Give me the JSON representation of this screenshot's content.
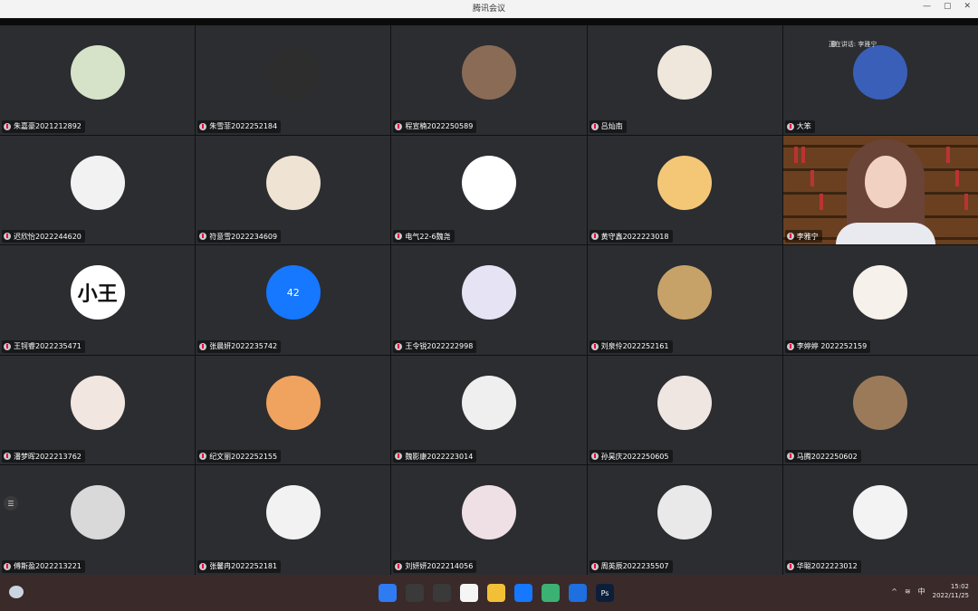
{
  "window": {
    "title": "腾讯会议"
  },
  "speaking": {
    "label": "正在讲话: 李雅宁"
  },
  "participants": [
    {
      "name": "朱嘉豪2021212892"
    },
    {
      "name": "朱雪菲2022252184"
    },
    {
      "name": "程宣楠2022250589"
    },
    {
      "name": "吕灿南"
    },
    {
      "name": "大笨"
    },
    {
      "name": "迟欣怡2022244620"
    },
    {
      "name": "符意雪2022234609"
    },
    {
      "name": "电气22-6魏尧"
    },
    {
      "name": "黄守鑫2022223018"
    },
    {
      "name": "李雅宁"
    },
    {
      "name": "王钶睿2022235471",
      "avatar_text": "小王"
    },
    {
      "name": "张晨妍2022235742",
      "avatar_text": "42"
    },
    {
      "name": "王令锐2022222998"
    },
    {
      "name": "刘泉伶2022252161"
    },
    {
      "name": "李婷婷 2022252159"
    },
    {
      "name": "潘梦晖2022213762"
    },
    {
      "name": "纪文丽2022252155"
    },
    {
      "name": "魏影康2022223014"
    },
    {
      "name": "孙昊庆2022250605"
    },
    {
      "name": "马腾2022250602"
    },
    {
      "name": "傅斯盈2022213221"
    },
    {
      "name": "张馨冉2022252181"
    },
    {
      "name": "刘妍妍2022214056"
    },
    {
      "name": "周英辰2022235507"
    },
    {
      "name": "华聪2022223012"
    }
  ],
  "avatar_colors": [
    "#d7e3c8",
    "#2d2d2d",
    "#8a6b55",
    "#efe6dc",
    "#3a5fb8",
    "#f2f2f2",
    "#efe3d4",
    "#ffffff",
    "#f4c777",
    "#6a4020",
    "#ffffff",
    "#1677ff",
    "#e6e3f4",
    "#c7a268",
    "#f6f1ea",
    "#f2e6e0",
    "#f0a35e",
    "#efefef",
    "#efe6e2",
    "#9b7a5a",
    "#d9d9d9",
    "#f2f2f2",
    "#efe0e6",
    "#e9e9e9",
    "#f3f3f3"
  ],
  "taskbar": {
    "apps": [
      "Windows",
      "Search",
      "Task View",
      "Tencent Meeting",
      "File Explorer",
      "Meeting",
      "App",
      "Phone",
      "Ps"
    ],
    "tray": {
      "ime": "中",
      "time": "15:02",
      "date": "2022/11/25"
    }
  }
}
